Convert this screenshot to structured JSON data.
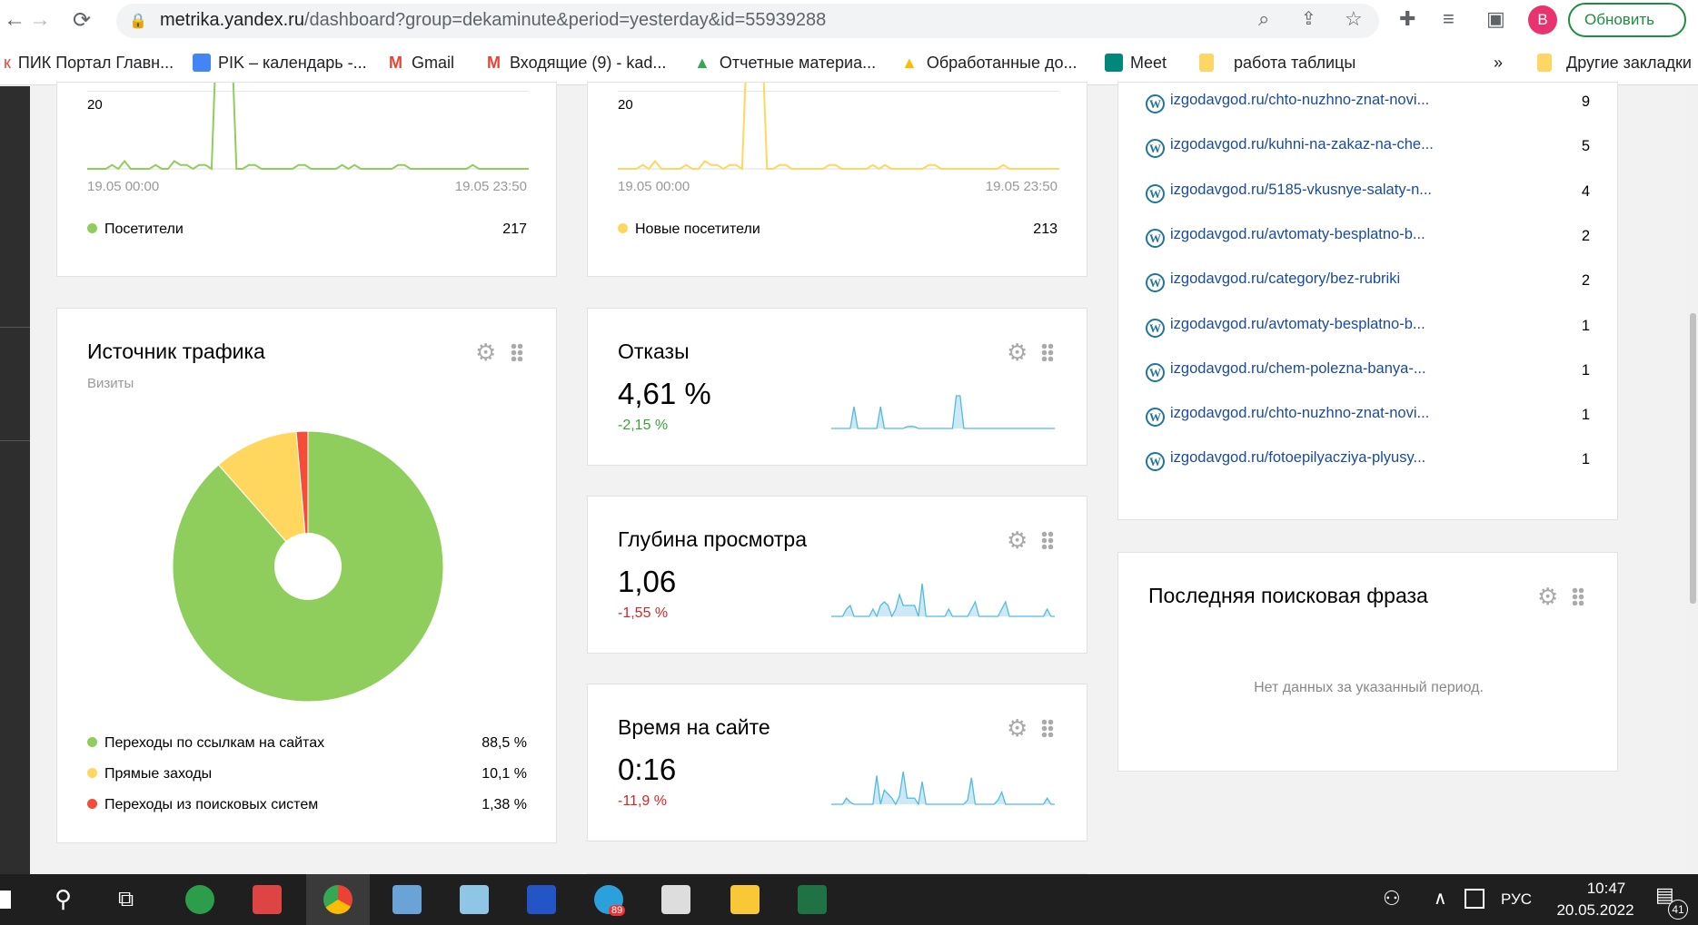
{
  "browser": {
    "url_host": "metrika.yandex.ru",
    "url_path": "/dashboard?group=dekaminute&period=yesterday&id=55939288",
    "profile_initial": "B",
    "update_label": "Обновить",
    "bookmarks": [
      "ПИК Портал Главн...",
      "PIK – календарь -...",
      "Gmail",
      "Входящие (9) - kad...",
      "Отчетные материа...",
      "Обработанные до...",
      "Meet",
      "работа таблицы"
    ],
    "more": "»",
    "other_bookmarks": "Другие закладки"
  },
  "colors": {
    "green": "#8fce5c",
    "yellow": "#ffd75e",
    "red": "#f44e3b",
    "spark": "#52bbe0"
  },
  "visitors": {
    "y_label": "20",
    "x_start": "19.05 00:00",
    "x_end": "19.05 23:50",
    "legend": "Посетители",
    "total": "217",
    "chart_data": {
      "type": "line",
      "x_start": "19.05 00:00",
      "x_end": "19.05 23:50",
      "ylim": [
        0,
        23
      ],
      "values": [
        0,
        0,
        0,
        0,
        1,
        0,
        2,
        0,
        0,
        0,
        0,
        1,
        0,
        0,
        2,
        1,
        1,
        0,
        1,
        1,
        0,
        44,
        30,
        44,
        0,
        0,
        1,
        1,
        0,
        0,
        0,
        0,
        0,
        0,
        1,
        1,
        0,
        0,
        0,
        0,
        0,
        1,
        0,
        1,
        0,
        0,
        0,
        0,
        0,
        0,
        1,
        1,
        0,
        0,
        0,
        0,
        0,
        0,
        0,
        0,
        0,
        0,
        1,
        0,
        0,
        0,
        0,
        0,
        0,
        0,
        0,
        0
      ]
    }
  },
  "new_visitors": {
    "y_label": "20",
    "x_start": "19.05 00:00",
    "x_end": "19.05 23:50",
    "legend": "Новые посетители",
    "total": "213",
    "chart_data": {
      "type": "line",
      "x_start": "19.05 00:00",
      "x_end": "19.05 23:50",
      "ylim": [
        0,
        23
      ],
      "values": [
        0,
        0,
        0,
        0,
        1,
        0,
        2,
        0,
        0,
        0,
        0,
        1,
        0,
        0,
        2,
        1,
        1,
        0,
        1,
        1,
        0,
        43,
        29,
        43,
        0,
        0,
        1,
        1,
        0,
        0,
        0,
        0,
        0,
        0,
        1,
        1,
        0,
        0,
        0,
        0,
        0,
        1,
        0,
        1,
        0,
        0,
        0,
        0,
        0,
        0,
        1,
        1,
        0,
        0,
        0,
        0,
        0,
        0,
        0,
        0,
        0,
        0,
        1,
        0,
        0,
        0,
        0,
        0,
        0,
        0,
        0,
        0
      ]
    }
  },
  "traffic": {
    "title": "Источник трафика",
    "subtitle": "Визиты",
    "chart_data": {
      "type": "pie",
      "labels": [
        "Переходы по ссылкам на сайтах",
        "Прямые заходы",
        "Переходы из поисковых систем"
      ],
      "values": [
        88.5,
        10.1,
        1.38
      ],
      "display": [
        "88,5 %",
        "10,1 %",
        "1,38 %"
      ]
    }
  },
  "bounce": {
    "title": "Отказы",
    "value": "4,61 %",
    "delta": "-2,15 %",
    "delta_color": "#3a9f3a",
    "spark": [
      0,
      0,
      0,
      0,
      0,
      0,
      6,
      0,
      0,
      0,
      0,
      0,
      0,
      6,
      0,
      0,
      0,
      0,
      0,
      0,
      0.5,
      0.6,
      0.5,
      0,
      0,
      0,
      0,
      0,
      0,
      0,
      0,
      0,
      0,
      9,
      9,
      0,
      0,
      0,
      0,
      0,
      0,
      0,
      0,
      0,
      0,
      0,
      0,
      0,
      0,
      0,
      0,
      0,
      0,
      0,
      0,
      0,
      0,
      0,
      0,
      0
    ]
  },
  "depth": {
    "title": "Глубина просмотра",
    "value": "1,06",
    "delta": "-1,55 %",
    "delta_color": "#d8232a",
    "spark": [
      0,
      0,
      0,
      0,
      2,
      3,
      0,
      0,
      0,
      0,
      0,
      2,
      0,
      3,
      4,
      3,
      0,
      2,
      6,
      3,
      3,
      3,
      3,
      0,
      9,
      0,
      0,
      0,
      0,
      0,
      0,
      2,
      0,
      0,
      0,
      0,
      0,
      2,
      4,
      0,
      0,
      0,
      0,
      0,
      0,
      2,
      4,
      0,
      0,
      0,
      0,
      0,
      0,
      0,
      0,
      0,
      0,
      2,
      0,
      0
    ]
  },
  "time": {
    "title": "Время на сайте",
    "value": "0:16",
    "delta": "-11,9 %",
    "delta_color": "#d8232a",
    "spark": [
      0,
      0,
      0,
      0,
      3,
      1,
      0,
      0,
      0,
      0,
      0,
      0,
      14,
      0,
      7,
      5,
      3,
      0,
      4,
      16,
      3,
      3,
      3,
      0,
      11,
      0,
      0,
      0,
      0,
      0,
      0,
      0,
      0,
      0,
      0,
      0,
      2,
      13,
      0,
      0,
      0,
      0,
      0,
      0,
      2,
      6,
      0,
      0,
      0,
      0,
      0,
      0,
      0,
      0,
      0,
      0,
      0,
      3,
      0,
      0
    ]
  },
  "pages": {
    "rows": [
      {
        "url": "izgodavgod.ru/chto-nuzhno-znat-novi...",
        "count": "9"
      },
      {
        "url": "izgodavgod.ru/kuhni-na-zakaz-na-che...",
        "count": "5"
      },
      {
        "url": "izgodavgod.ru/5185-vkusnye-salaty-n...",
        "count": "4"
      },
      {
        "url": "izgodavgod.ru/avtomaty-besplatno-b...",
        "count": "2"
      },
      {
        "url": "izgodavgod.ru/category/bez-rubriki",
        "count": "2"
      },
      {
        "url": "izgodavgod.ru/avtomaty-besplatno-b...",
        "count": "1"
      },
      {
        "url": "izgodavgod.ru/chem-polezna-banya-...",
        "count": "1"
      },
      {
        "url": "izgodavgod.ru/chto-nuzhno-znat-novi...",
        "count": "1"
      },
      {
        "url": "izgodavgod.ru/fotoepilyacziya-plyusy...",
        "count": "1"
      }
    ]
  },
  "search": {
    "title": "Последняя поисковая фраза",
    "empty": "Нет данных за указанный период."
  },
  "taskbar": {
    "telegram_badge": "89",
    "lang": "РУС",
    "time": "10:47",
    "date": "20.05.2022",
    "notifications": "41"
  }
}
